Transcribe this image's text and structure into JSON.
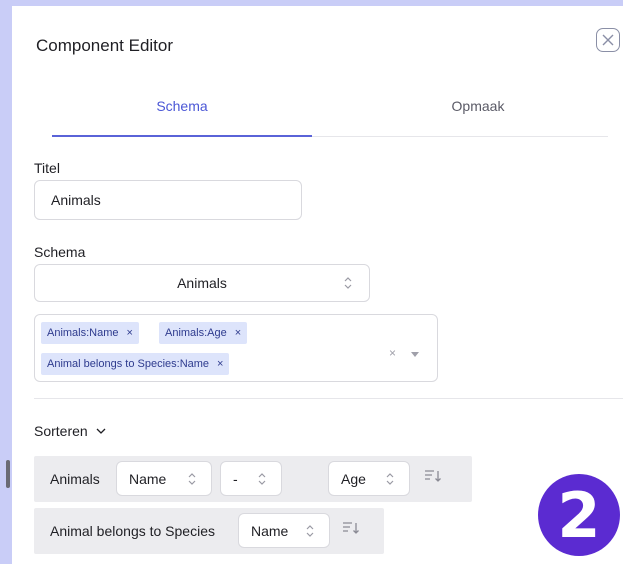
{
  "editor": {
    "title": "Component Editor",
    "tabs": [
      {
        "label": "Schema",
        "active": true
      },
      {
        "label": "Opmaak",
        "active": false
      }
    ],
    "titel": {
      "label": "Titel",
      "value": "Animals"
    },
    "schema": {
      "label": "Schema",
      "selected": "Animals",
      "fields": [
        {
          "label": "Animals:Name"
        },
        {
          "label": "Animals:Age"
        },
        {
          "label": "Animal belongs to Species:Name"
        }
      ]
    },
    "sort": {
      "label": "Sorteren",
      "rows": [
        {
          "entity": "Animals",
          "field1": "Name",
          "field2": "-",
          "field3": "Age"
        },
        {
          "entity": "Animal belongs to Species",
          "field1": "Name"
        }
      ]
    }
  },
  "badge": {
    "number": "2"
  },
  "colors": {
    "accent": "#4b57d6",
    "tag_bg": "#dde4fb",
    "badge": "#5b2bd1",
    "backdrop": "#c9cdf7"
  }
}
